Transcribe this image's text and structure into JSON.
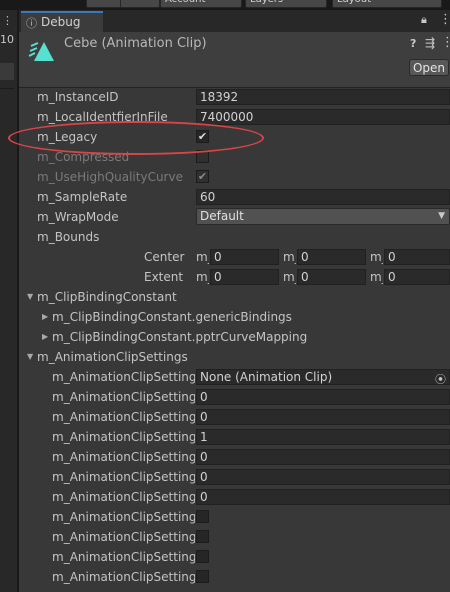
{
  "toolbar": {
    "account_label": "Account",
    "layers_label": "Layers",
    "layout_label": "Layout"
  },
  "left_window": {
    "frame_number": "10"
  },
  "tab": {
    "icon": "info-icon",
    "label": "Debug",
    "lock_icon": "lock-icon",
    "menu_icon": "kebab-menu-icon"
  },
  "header": {
    "asset_icon": "animation-clip-icon",
    "title": "Cebe (Animation Clip)",
    "help_icon": "help-icon",
    "presets_icon": "presets-icon",
    "more_icon": "kebab-menu-icon",
    "open_label": "Open"
  },
  "properties": {
    "instance_id": {
      "label": "m_InstanceID",
      "value": "18392"
    },
    "local_id": {
      "label": "m_LocalIdentfierInFile",
      "value": "7400000"
    },
    "legacy": {
      "label": "m_Legacy",
      "checked": true
    },
    "compressed": {
      "label": "m_Compressed",
      "checked": false
    },
    "high_quality": {
      "label": "m_UseHighQualityCurve",
      "checked": true
    },
    "sample_rate": {
      "label": "m_SampleRate",
      "value": "60"
    },
    "wrap_mode": {
      "label": "m_WrapMode",
      "value": "Default"
    },
    "bounds": {
      "label": "m_Bounds",
      "center_label": "Center",
      "extent_label": "Extent",
      "axis_prefix": "m_",
      "center": [
        "0",
        "0",
        "0"
      ],
      "extent": [
        "0",
        "0",
        "0"
      ]
    },
    "clip_binding": {
      "label": "m_ClipBindingConstant",
      "generic": "m_ClipBindingConstant.genericBindings",
      "pptr": "m_ClipBindingConstant.pptrCurveMapping"
    },
    "settings": {
      "label": "m_AnimationClipSettings",
      "row_label": "m_AnimationClipSettings.",
      "additive_ref": "None (Animation Clip)",
      "values": [
        "0",
        "0",
        "1",
        "0",
        "0",
        "0"
      ],
      "checkboxes": [
        false,
        false,
        false,
        false
      ]
    }
  },
  "annotation": {
    "color": "#d84447",
    "shape": "ellipse-around-legacy"
  }
}
